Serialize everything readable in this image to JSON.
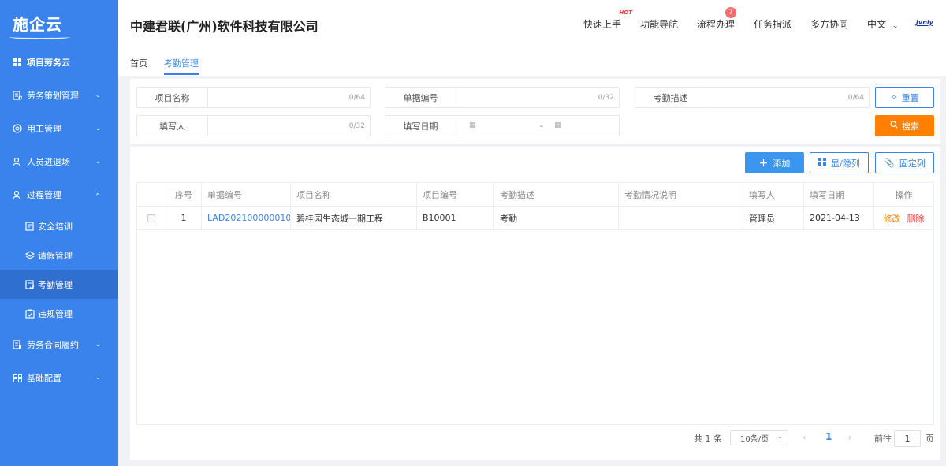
{
  "sidebar": {
    "logo": "施企云",
    "items": [
      {
        "label": "项目劳务云",
        "icon": "grid-icon"
      },
      {
        "label": "劳务策划管理",
        "icon": "document-plan-icon"
      },
      {
        "label": "用工管理",
        "icon": "circle-settings-icon"
      },
      {
        "label": "人员进退场",
        "icon": "person-icon"
      },
      {
        "label": "过程管理",
        "icon": "person-process-icon"
      },
      {
        "label": "劳务合同履约",
        "icon": "contract-icon"
      },
      {
        "label": "基础配置",
        "icon": "config-grid-icon"
      }
    ],
    "sub_items": [
      {
        "label": "安全培训",
        "icon": "training-icon"
      },
      {
        "label": "请假管理",
        "icon": "layers-icon"
      },
      {
        "label": "考勤管理",
        "icon": "attendance-icon"
      },
      {
        "label": "违规管理",
        "icon": "clipboard-check-icon"
      }
    ]
  },
  "header": {
    "company": "中建君联(广州)软件科技有限公司",
    "nav": [
      "快速上手",
      "功能导航",
      "流程办理",
      "任务指派",
      "多方协同"
    ],
    "hot_label": "HOT",
    "badge_count": "7",
    "language": "中文",
    "brand": "Jvnly"
  },
  "breadcrumb": {
    "home": "首页",
    "current": "考勤管理"
  },
  "filters": {
    "project_name": {
      "label": "项目名称",
      "counter": "0/64"
    },
    "doc_no": {
      "label": "单据编号",
      "counter": "0/32"
    },
    "attendance_desc": {
      "label": "考勤描述",
      "counter": "0/64"
    },
    "filler": {
      "label": "填写人",
      "counter": "0/32"
    },
    "fill_date": {
      "label": "填写日期",
      "separator": "-"
    },
    "reset_label": "重置",
    "search_label": "搜索"
  },
  "toolbar": {
    "add_label": "添加",
    "toggle_columns_label": "显/隐列",
    "fix_columns_label": "固定列"
  },
  "table": {
    "columns": [
      "序号",
      "单据编号",
      "项目名称",
      "项目编号",
      "考勤描述",
      "考勤情况说明",
      "填写人",
      "填写日期",
      "操作"
    ],
    "rows": [
      {
        "index": "1",
        "doc_no": "LAD202100000010",
        "project_name": "碧桂园生态城一期工程",
        "project_no": "B10001",
        "desc": "考勤",
        "remark": "",
        "filler": "管理员",
        "date": "2021-04-13",
        "edit_label": "修改",
        "delete_label": "删除"
      }
    ]
  },
  "pagination": {
    "total_text": "共 1 条",
    "page_size": "10条/页",
    "current_page": "1",
    "goto_label": "前往",
    "goto_value": "1",
    "page_unit": "页"
  },
  "colors": {
    "sidebar_bg": "#3a83ec",
    "primary": "#3a83ec",
    "search_btn": "#ff7f00",
    "delete": "#f23d3d"
  }
}
